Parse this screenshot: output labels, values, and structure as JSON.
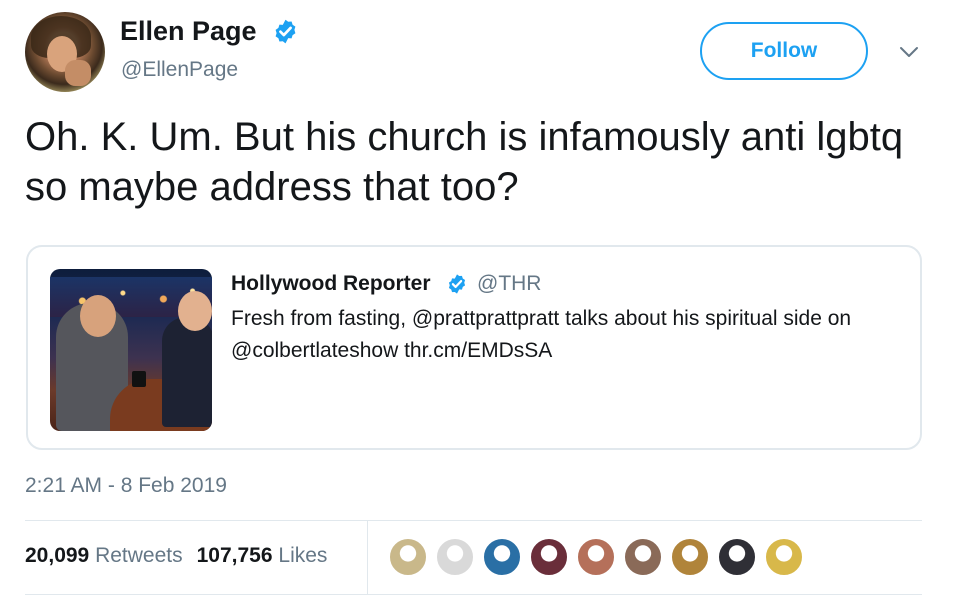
{
  "author": {
    "name": "Ellen Page",
    "handle": "@EllenPage",
    "verified": true
  },
  "follow_button": {
    "label": "Follow"
  },
  "tweet": {
    "text": "Oh. K. Um. But his church is infamously anti lgbtq so maybe address that too?",
    "timestamp": "2:21 AM - 8 Feb 2019"
  },
  "quoted_tweet": {
    "name": "Hollywood Reporter",
    "handle": "@THR",
    "verified": true,
    "text": "Fresh from fasting, @prattprattpratt talks about his spiritual side on @colbertlateshow thr.cm/EMDsSA"
  },
  "stats": {
    "retweets_count": "20,099",
    "retweets_label": "Retweets",
    "likes_count": "107,756",
    "likes_label": "Likes"
  },
  "likers": [
    {
      "name": "liker-avatar-1",
      "color": "#c9b88a"
    },
    {
      "name": "liker-avatar-2",
      "color": "#d9d9d9"
    },
    {
      "name": "liker-avatar-3",
      "color": "#2a6fa5"
    },
    {
      "name": "liker-avatar-4",
      "color": "#6a2e3a"
    },
    {
      "name": "liker-avatar-5",
      "color": "#b5705a"
    },
    {
      "name": "liker-avatar-6",
      "color": "#8a6a58"
    },
    {
      "name": "liker-avatar-7",
      "color": "#b0843a"
    },
    {
      "name": "liker-avatar-8",
      "color": "#2f2f36"
    },
    {
      "name": "liker-avatar-9",
      "color": "#d8b84a"
    }
  ],
  "colors": {
    "accent": "#1da1f2",
    "text_primary": "#14171a",
    "text_secondary": "#657786",
    "border": "#e1e8ed"
  }
}
